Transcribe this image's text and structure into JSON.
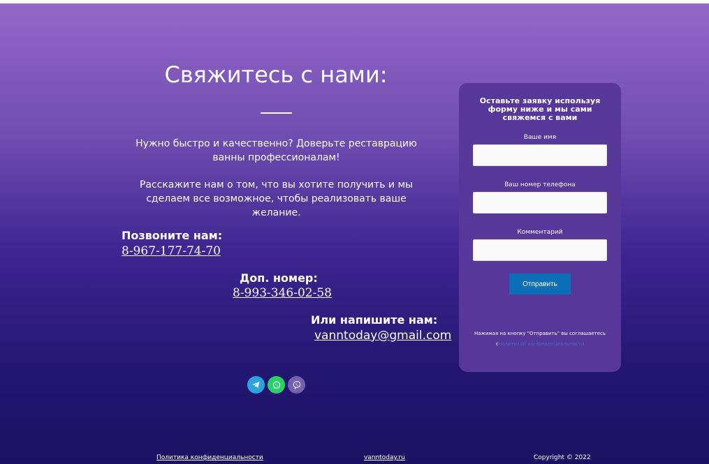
{
  "contact": {
    "heading": "Свяжитесь с нами:",
    "intro1": "Нужно быстро и качественно? Доверьте реставрацию ванны профессионалам!",
    "intro2": "Расскажите нам о том, что вы хотите получить и мы сделаем все возможное, чтобы реализовать ваше желание.",
    "call_label": "Позвоните нам:",
    "call_phone": "8-967-177-74-70",
    "extra_label": "Доп. номер:",
    "extra_phone": "8-993-346-02-58",
    "write_label": "Или напишите нам:",
    "email": "vanntoday@gmail.com"
  },
  "social": [
    {
      "icon": "telegram-icon",
      "color": "#2aa3de"
    },
    {
      "icon": "whatsapp-icon",
      "color": "#27d266"
    },
    {
      "icon": "viber-icon",
      "color": "#7360b1"
    }
  ],
  "form": {
    "title": "Оставьте заявку используя форму ниже и мы сами свяжемся с вами",
    "name_label": "Ваше имя",
    "phone_label": "Ваш номер телефона",
    "comment_label": "Комментарий",
    "submit_label": "Отправить",
    "consent_text": "Нажимая на кнопку \"Отправить\" вы соглашаетесь с",
    "consent_link": "политикой конфиденциальности"
  },
  "footer": {
    "privacy": "Политика конфиденциальности",
    "site": "vanntoday.ru",
    "copyright": "Copyright © 2022"
  },
  "colors": {
    "accent_button": "#0b6fb6",
    "card_bg": "#58379a"
  }
}
